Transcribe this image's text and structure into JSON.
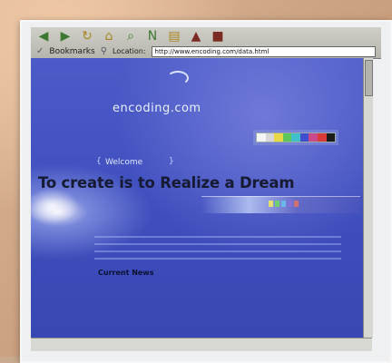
{
  "browser": {
    "bookmarks_label": "Bookmarks",
    "location_label": "Location:",
    "url": "http://www.encoding.com/data.html",
    "toolbar_icons": [
      "back-arrow-icon",
      "forward-arrow-icon",
      "reload-icon",
      "home-icon",
      "search-icon",
      "netscape-icon",
      "print-icon",
      "security-icon",
      "stop-icon"
    ]
  },
  "page": {
    "logo": "encoding.com",
    "welcome": "Welcome",
    "headline": "To create is to Realize a Dream",
    "news_heading": "Current News",
    "colorbar": [
      "#f5f5f5",
      "#d8d8d8",
      "#e8d846",
      "#5ec65a",
      "#3fbfc9",
      "#3f4fd0",
      "#c84a8a",
      "#d83a3a",
      "#1b1b1b"
    ],
    "streak_colors": [
      "#e4e070",
      "#6ecf6e",
      "#6ab7e8",
      "#8070d8",
      "#d07070"
    ]
  }
}
